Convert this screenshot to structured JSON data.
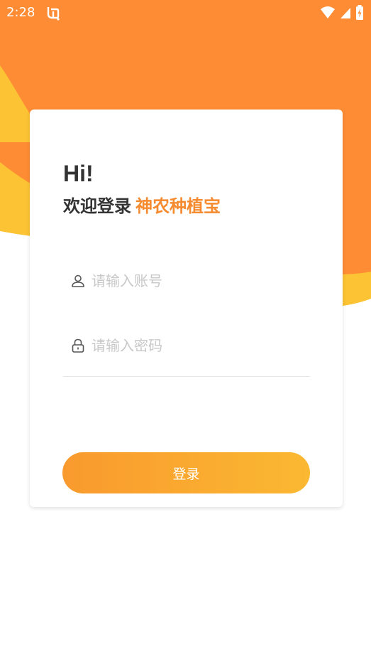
{
  "status_bar": {
    "time": "2:28",
    "app_icon": "bug-icon",
    "wifi_icon": "wifi-icon",
    "signal_icon": "cell-signal-icon",
    "battery_icon": "battery-charging-icon"
  },
  "login": {
    "greeting": "Hi!",
    "welcome_text": "欢迎登录",
    "brand_name": "神农种植宝",
    "account_icon": "user-icon",
    "account_placeholder": "请输入账号",
    "account_value": "",
    "password_icon": "lock-icon",
    "password_placeholder": "请输入密码",
    "password_value": "",
    "login_button_label": "登录"
  },
  "colors": {
    "brand_orange": "#f58a2f",
    "background_orange": "#fe8c34",
    "background_yellow": "#fcc334",
    "button_gradient_start": "#f99a2e",
    "button_gradient_end": "#fbb832",
    "text_dark": "#333333",
    "placeholder_gray": "#c8c8c8"
  }
}
